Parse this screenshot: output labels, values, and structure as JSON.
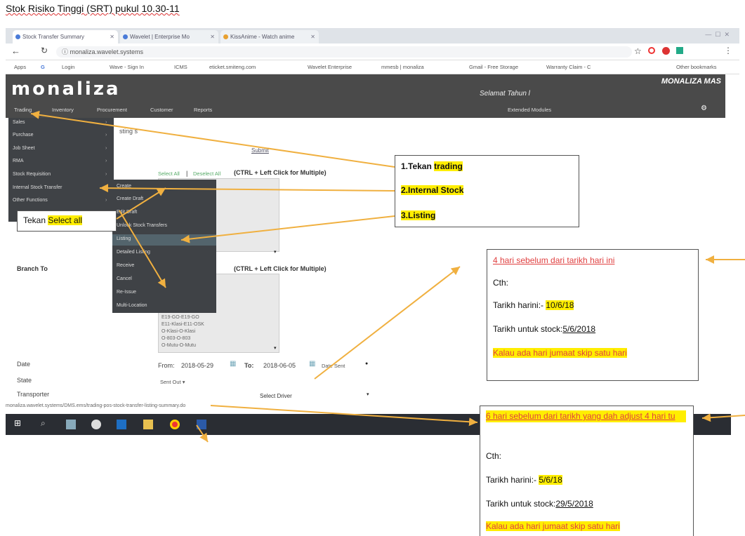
{
  "doc_title": "Stok Risiko Tinggi (SRT) pukul 10.30-11",
  "browser": {
    "tabs": [
      {
        "label": "Stock Transfer Summary",
        "color": "#4a7bd8"
      },
      {
        "label": "Wavelet | Enterprise Mo",
        "color": "#4a7bd8"
      },
      {
        "label": "KissAnime - Watch anime",
        "color": "#e8a030"
      }
    ],
    "url": "monaliza.wavelet.systems",
    "bookmarks": [
      "Apps",
      "G",
      "Login",
      "Wave - Sign In",
      "ICMS",
      "eticket.smiteng.com",
      "Wavelet Enterprise",
      "mmesb | monaliza",
      "Gmail - Free Storage",
      "Warranty Claim - C",
      "Other bookmarks"
    ]
  },
  "app": {
    "logo": "monaliza",
    "brand": "MONALIZA MAS",
    "greeting": "Selamat Tahun l",
    "nav": [
      "Trading",
      "Inventory",
      "Procurement",
      "Customer",
      "Reports",
      "Extended Modules"
    ],
    "listing_heading": "sting s",
    "submit": "Submit",
    "select_all": "Select All",
    "deselect_all": "Deselect All",
    "ctrl_hint": "(CTRL + Left Click for Multiple)",
    "branch_to_label": "Branch To",
    "branch_options": [
      "E19-GO-E19-GO",
      "E11-Klasi-E11-OSK",
      "O-Klasi-O-Klasi",
      "O-803-O-803",
      "O-Mutu-O-Mutu"
    ],
    "date_label": "Date",
    "date_from_label": "From:",
    "date_from": "2018-05-29",
    "date_to_label": "To:",
    "date_to": "2018-06-05",
    "date_type": "Date Sent",
    "state_label": "State",
    "state_value": "Sent Out",
    "transporter_label": "Transporter",
    "transporter_value": "Select Driver",
    "status_url": "monaliza.wavelet.systems/DMS.ems/trading-pos-stock-transfer-listing-summary.do"
  },
  "side_menu": [
    "Sales",
    "Purchase",
    "Job Sheet",
    "RMA",
    "Stock Requisition",
    "Internal Stock Transfer",
    "Other Functions"
  ],
  "sub_menu": [
    "Create",
    "Create Draft",
    "Edit Draft",
    "Unlock Stock Transfers",
    "Listing",
    "Detailed Listing",
    "Receive",
    "Cancel",
    "Re-Issue",
    "Multi-Location"
  ],
  "callout_select": {
    "prefix": "Tekan",
    "highlight": "Select all"
  },
  "callout_steps": {
    "step1_prefix": "1.Tekan",
    "step1_hl": "trading",
    "step2": "2.Internal Stock",
    "step3": "3.Listing"
  },
  "callout_4days": {
    "title": "4 hari sebelum dari tarikh hari ini",
    "cth": "Cth:",
    "today_label": "Tarikh harini:-",
    "today_value": "10/6/18",
    "stock_label": "Tarikh untuk stock:",
    "stock_value": "5/6/2018",
    "note": "Kalau ada hari jumaat skip satu hari"
  },
  "callout_6days": {
    "title": "6 hari sebelum dari tarikh yang dah adjust 4 hari tu",
    "cth": "Cth:",
    "today_label": "Tarikh harini:-",
    "today_value": "5/6/18",
    "stock_label": "Tarikh untuk stock:",
    "stock_value": "29/5/2018",
    "note": "Kalau ada hari jumaat skip satu hari"
  },
  "colors": {
    "highlight": "#ffee00",
    "arrow": "#f0b040",
    "header_bg": "#4a4a4a",
    "menu_bg": "#3f4246"
  }
}
